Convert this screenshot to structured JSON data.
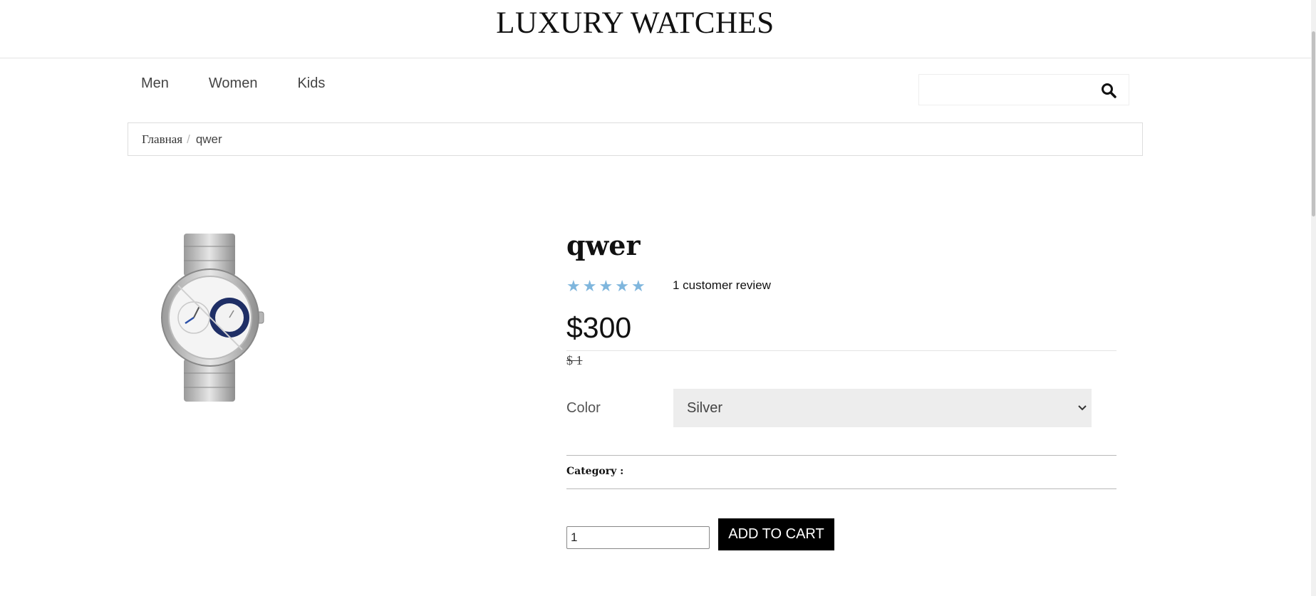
{
  "site": {
    "logo": "LUXURY WATCHES"
  },
  "nav": {
    "items": [
      "Men",
      "Women",
      "Kids"
    ]
  },
  "search": {
    "placeholder": "",
    "value": "",
    "icon": "search-icon"
  },
  "breadcrumb": {
    "home": "Главная",
    "separator": "/",
    "current": "qwer"
  },
  "product": {
    "title": "qwer",
    "rating": 5,
    "rating_max": 5,
    "stars": "★★★★★",
    "review_text": "1 customer review",
    "price": "$300",
    "old_price": "$ 1",
    "color_label": "Color",
    "color_selected": "Silver",
    "category_label": "Category :",
    "quantity": "1",
    "add_to_cart": "ADD TO CART",
    "image": "silver-wristwatch"
  },
  "colors": {
    "star": "#7fb6dd",
    "button_bg": "#000000",
    "select_bg": "#ededed"
  }
}
